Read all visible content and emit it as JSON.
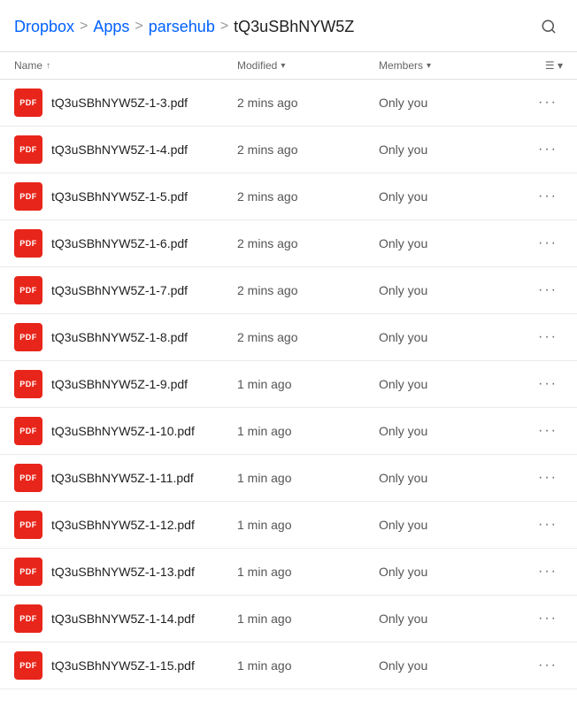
{
  "breadcrumb": {
    "root": "Dropbox",
    "sep1": ">",
    "apps": "Apps",
    "sep2": ">",
    "parsehub": "parsehub",
    "sep3": ">",
    "current": "tQ3uSBhNYW5Z"
  },
  "search_label": "Search",
  "columns": {
    "name": "Name",
    "name_sort": "↑",
    "modified": "Modified",
    "modified_sort": "▾",
    "members": "Members",
    "members_sort": "▾",
    "actions": "☰ ▾"
  },
  "files": [
    {
      "name": "tQ3uSBhNYW5Z-1-3.pdf",
      "modified": "2 mins ago",
      "members": "Only you"
    },
    {
      "name": "tQ3uSBhNYW5Z-1-4.pdf",
      "modified": "2 mins ago",
      "members": "Only you"
    },
    {
      "name": "tQ3uSBhNYW5Z-1-5.pdf",
      "modified": "2 mins ago",
      "members": "Only you"
    },
    {
      "name": "tQ3uSBhNYW5Z-1-6.pdf",
      "modified": "2 mins ago",
      "members": "Only you"
    },
    {
      "name": "tQ3uSBhNYW5Z-1-7.pdf",
      "modified": "2 mins ago",
      "members": "Only you"
    },
    {
      "name": "tQ3uSBhNYW5Z-1-8.pdf",
      "modified": "2 mins ago",
      "members": "Only you"
    },
    {
      "name": "tQ3uSBhNYW5Z-1-9.pdf",
      "modified": "1 min ago",
      "members": "Only you"
    },
    {
      "name": "tQ3uSBhNYW5Z-1-10.pdf",
      "modified": "1 min ago",
      "members": "Only you"
    },
    {
      "name": "tQ3uSBhNYW5Z-1-11.pdf",
      "modified": "1 min ago",
      "members": "Only you"
    },
    {
      "name": "tQ3uSBhNYW5Z-1-12.pdf",
      "modified": "1 min ago",
      "members": "Only you"
    },
    {
      "name": "tQ3uSBhNYW5Z-1-13.pdf",
      "modified": "1 min ago",
      "members": "Only you"
    },
    {
      "name": "tQ3uSBhNYW5Z-1-14.pdf",
      "modified": "1 min ago",
      "members": "Only you"
    },
    {
      "name": "tQ3uSBhNYW5Z-1-15.pdf",
      "modified": "1 min ago",
      "members": "Only you"
    }
  ],
  "pdf_label": "PDF"
}
